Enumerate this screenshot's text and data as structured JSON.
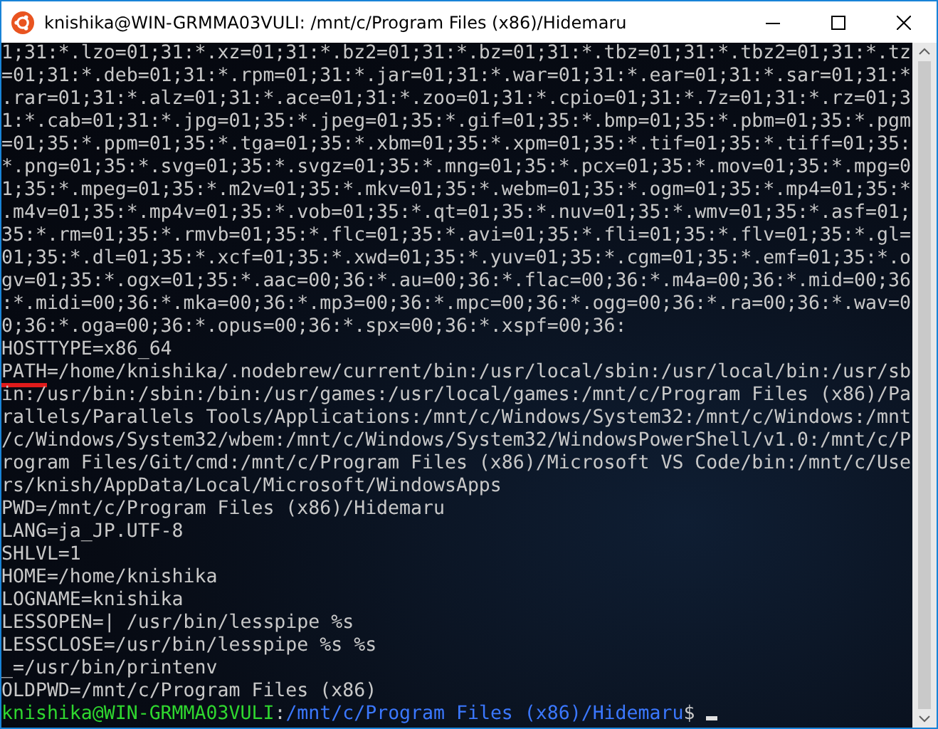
{
  "window": {
    "title": "knishika@WIN-GRMMA03VULI: /mnt/c/Program Files (x86)/Hidemaru"
  },
  "terminal": {
    "lines": [
      {
        "text": "1;31:*.lzo=01;31:*.xz=01;31:*.bz2=01;31:*.bz=01;31:*.tbz=01;31:*.tbz2=01;31:*.tz"
      },
      {
        "text": "=01;31:*.deb=01;31:*.rpm=01;31:*.jar=01;31:*.war=01;31:*.ear=01;31:*.sar=01;31:*"
      },
      {
        "text": ".rar=01;31:*.alz=01;31:*.ace=01;31:*.zoo=01;31:*.cpio=01;31:*.7z=01;31:*.rz=01;3"
      },
      {
        "text": "1:*.cab=01;31:*.jpg=01;35:*.jpeg=01;35:*.gif=01;35:*.bmp=01;35:*.pbm=01;35:*.pgm"
      },
      {
        "text": "=01;35:*.ppm=01;35:*.tga=01;35:*.xbm=01;35:*.xpm=01;35:*.tif=01;35:*.tiff=01;35:"
      },
      {
        "text": "*.png=01;35:*.svg=01;35:*.svgz=01;35:*.mng=01;35:*.pcx=01;35:*.mov=01;35:*.mpg=0"
      },
      {
        "text": "1;35:*.mpeg=01;35:*.m2v=01;35:*.mkv=01;35:*.webm=01;35:*.ogm=01;35:*.mp4=01;35:*"
      },
      {
        "text": ".m4v=01;35:*.mp4v=01;35:*.vob=01;35:*.qt=01;35:*.nuv=01;35:*.wmv=01;35:*.asf=01;"
      },
      {
        "text": "35:*.rm=01;35:*.rmvb=01;35:*.flc=01;35:*.avi=01;35:*.fli=01;35:*.flv=01;35:*.gl="
      },
      {
        "text": "01;35:*.dl=01;35:*.xcf=01;35:*.xwd=01;35:*.yuv=01;35:*.cgm=01;35:*.emf=01;35:*.o"
      },
      {
        "text": "gv=01;35:*.ogx=01;35:*.aac=00;36:*.au=00;36:*.flac=00;36:*.m4a=00;36:*.mid=00;36"
      },
      {
        "text": ":*.midi=00;36:*.mka=00;36:*.mp3=00;36:*.mpc=00;36:*.ogg=00;36:*.ra=00;36:*.wav=0"
      },
      {
        "text": "0;36:*.oga=00;36:*.opus=00;36:*.spx=00;36:*.xspf=00;36:"
      },
      {
        "text": "HOSTTYPE=x86_64"
      },
      {
        "text": "PATH=/home/knishika/.nodebrew/current/bin:/usr/local/sbin:/usr/local/bin:/usr/sb",
        "underlined": true
      },
      {
        "text": "in:/usr/bin:/sbin:/bin:/usr/games:/usr/local/games:/mnt/c/Program Files (x86)/Pa"
      },
      {
        "text": "rallels/Parallels Tools/Applications:/mnt/c/Windows/System32:/mnt/c/Windows:/mnt"
      },
      {
        "text": "/c/Windows/System32/wbem:/mnt/c/Windows/System32/WindowsPowerShell/v1.0:/mnt/c/P"
      },
      {
        "text": "rogram Files/Git/cmd:/mnt/c/Program Files (x86)/Microsoft VS Code/bin:/mnt/c/Use"
      },
      {
        "text": "rs/knish/AppData/Local/Microsoft/WindowsApps"
      },
      {
        "text": "PWD=/mnt/c/Program Files (x86)/Hidemaru"
      },
      {
        "text": "LANG=ja_JP.UTF-8"
      },
      {
        "text": "SHLVL=1"
      },
      {
        "text": "HOME=/home/knishika"
      },
      {
        "text": "LOGNAME=knishika"
      },
      {
        "text": "LESSOPEN=| /usr/bin/lesspipe %s"
      },
      {
        "text": "LESSCLOSE=/usr/bin/lesspipe %s %s"
      },
      {
        "text": "_=/usr/bin/printenv"
      },
      {
        "text": "OLDPWD=/mnt/c/Program Files (x86)"
      }
    ],
    "prompt": {
      "user_host": "knishika@WIN-GRMMA03VULI",
      "separator": ":",
      "path": "/mnt/c/Program Files (x86)/Hidemaru",
      "symbol": "$"
    }
  }
}
